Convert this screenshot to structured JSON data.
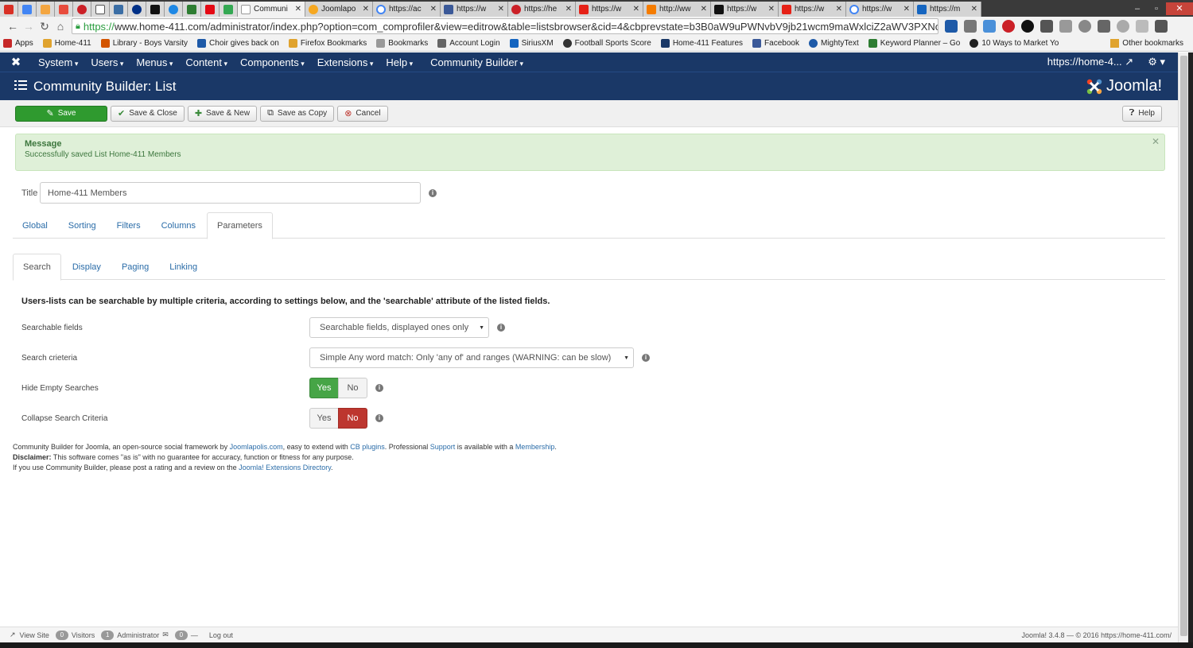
{
  "browser": {
    "tabs": [
      {
        "title": "Communi"
      },
      {
        "title": "Joomlapo"
      },
      {
        "title": "https://ac"
      },
      {
        "title": "https://w"
      },
      {
        "title": "https://he"
      },
      {
        "title": "https://w"
      },
      {
        "title": "http://ww"
      },
      {
        "title": "https://w"
      },
      {
        "title": "https://w"
      },
      {
        "title": "https://w"
      },
      {
        "title": "https://m"
      }
    ],
    "url_scheme": "https://",
    "url_rest": "www.home-411.com/administrator/index.php?option=com_comprofiler&view=editrow&table=listsbrowser&cid=4&cbprevstate=b3B0aW9uPWNvbV9jb21wcm9maWxlciZ2aWV3PXNob3",
    "bookmarks": [
      "Apps",
      "Home-411",
      "Library - Boys Varsity",
      "Choir gives back on",
      "Firefox Bookmarks",
      "Bookmarks",
      "Account Login",
      "SiriusXM",
      "Football Sports Score",
      "Home-411 Features",
      "Facebook",
      "MightyText",
      "Keyword Planner – Go",
      "10 Ways to Market Yo"
    ],
    "other_bookmarks": "Other bookmarks"
  },
  "admin_menu": {
    "items": [
      "System",
      "Users",
      "Menus",
      "Content",
      "Components",
      "Extensions",
      "Help",
      "Community Builder"
    ],
    "site_link": "https://home-4...",
    "settings_icon": "gear-icon"
  },
  "header": {
    "title": "Community Builder: List",
    "brand": "Joomla!"
  },
  "toolbar": {
    "save": "Save",
    "save_close": "Save & Close",
    "save_new": "Save & New",
    "save_copy": "Save as Copy",
    "cancel": "Cancel",
    "help": "Help"
  },
  "message": {
    "heading": "Message",
    "text": "Successfully saved List Home-411 Members"
  },
  "form": {
    "title_label": "Title",
    "title_value": "Home-411 Members"
  },
  "tabs_main": [
    "Global",
    "Sorting",
    "Filters",
    "Columns",
    "Parameters"
  ],
  "tabs_sub": [
    "Search",
    "Display",
    "Paging",
    "Linking"
  ],
  "intro": "Users-lists can be searchable by multiple criteria, according to settings below, and the 'searchable' attribute of the listed fields.",
  "fields": {
    "searchable_label": "Searchable fields",
    "searchable_value": "Searchable fields, displayed ones only",
    "criteria_label": "Search crieteria",
    "criteria_value": "Simple Any word match: Only 'any of' and ranges (WARNING: can be slow)",
    "hide_empty_label": "Hide Empty Searches",
    "collapse_label": "Collapse Search Criteria",
    "yes": "Yes",
    "no": "No"
  },
  "footnote": {
    "l1a": "Community Builder for Joomla, an open-source social framework by ",
    "l1b": "Joomlapolis.com",
    "l1c": ", easy to extend with ",
    "l1d": "CB plugins",
    "l1e": ". Professional ",
    "l1f": "Support",
    "l1g": " is available with a ",
    "l1h": "Membership",
    "l1i": ".",
    "l2a": "Disclaimer:",
    "l2b": " This software comes \"as is\" with no guarantee for accuracy, function or fitness for any purpose.",
    "l3a": "If you use Community Builder, please post a rating and a review on the ",
    "l3b": "Joomla! Extensions Directory",
    "l3c": "."
  },
  "status": {
    "view_site": "View Site",
    "visitors_count": "0",
    "visitors": "Visitors",
    "admin_count": "1",
    "administrator": "Administrator",
    "messages_count": "0",
    "logout": "Log out",
    "version": "Joomla! 3.4.8 — © 2016 https://home-411.com/"
  },
  "colors": {
    "navy": "#1a3867",
    "save_green": "#2f9a2f",
    "yes_green": "#46a546",
    "no_red": "#bd362f",
    "link_blue": "#2a6ca8",
    "message_bg": "#dff0d8"
  }
}
